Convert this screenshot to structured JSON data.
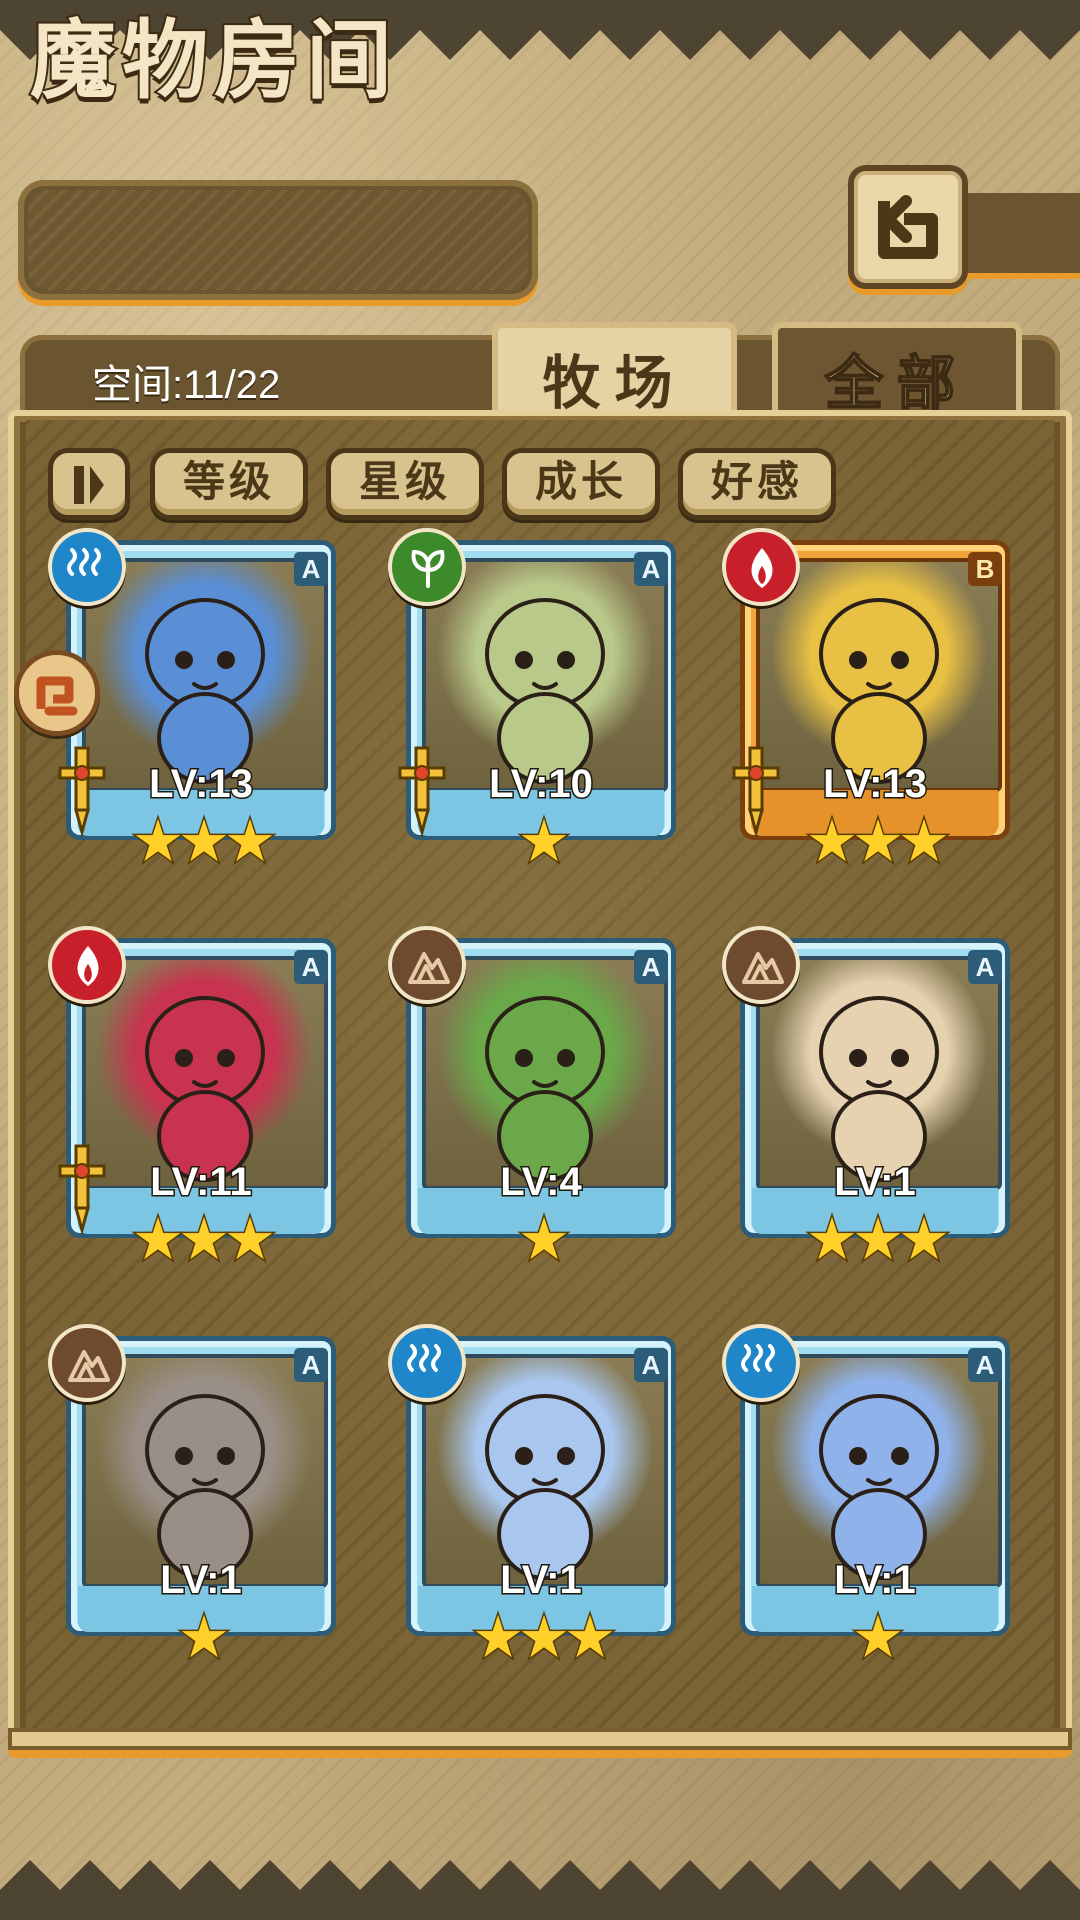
{
  "header": {
    "title": "魔物房间",
    "back_icon": "back-arrow-icon"
  },
  "info": {
    "space_text": "空间:11/22"
  },
  "tabs": [
    {
      "label": "牧场",
      "active": true
    },
    {
      "label": "全部",
      "active": false
    }
  ],
  "sort_bar": {
    "toggle_icon": "pause-sort-icon",
    "buttons": [
      "等级",
      "星级",
      "成长",
      "好感"
    ]
  },
  "leader_badge_icon": "leader-arrow-icon",
  "monsters": [
    {
      "level": "LV:13",
      "stars": "★★★",
      "rank": "A",
      "element": "water",
      "frame": "blue",
      "equipped": true,
      "portrait_color": "#5a8fd6"
    },
    {
      "level": "LV:10",
      "stars": "★",
      "rank": "A",
      "element": "plant",
      "frame": "blue",
      "equipped": true,
      "portrait_color": "#b9c98a"
    },
    {
      "level": "LV:13",
      "stars": "★★★",
      "rank": "B",
      "element": "fire",
      "frame": "orange",
      "equipped": true,
      "portrait_color": "#e8c044"
    },
    {
      "level": "LV:11",
      "stars": "★★★",
      "rank": "A",
      "element": "fire",
      "frame": "blue",
      "equipped": true,
      "portrait_color": "#c8334f"
    },
    {
      "level": "LV:4",
      "stars": "★",
      "rank": "A",
      "element": "earth",
      "frame": "blue",
      "equipped": false,
      "portrait_color": "#6aa84a"
    },
    {
      "level": "LV:1",
      "stars": "★★★",
      "rank": "A",
      "element": "earth",
      "frame": "blue",
      "equipped": false,
      "portrait_color": "#e6d2b0"
    },
    {
      "level": "LV:1",
      "stars": "★",
      "rank": "A",
      "element": "earth",
      "frame": "blue",
      "equipped": false,
      "portrait_color": "#9a8f86"
    },
    {
      "level": "LV:1",
      "stars": "★★★",
      "rank": "A",
      "element": "water",
      "frame": "blue",
      "equipped": false,
      "portrait_color": "#a8c6ee"
    },
    {
      "level": "LV:1",
      "stars": "★",
      "rank": "A",
      "element": "water",
      "frame": "blue",
      "equipped": false,
      "portrait_color": "#8fb2ea"
    }
  ],
  "colors": {
    "accent_orange": "#e89a2a",
    "water": "#1f87c9",
    "fire": "#c8202a",
    "plant": "#3c8a2a",
    "earth": "#6e4a2e"
  }
}
